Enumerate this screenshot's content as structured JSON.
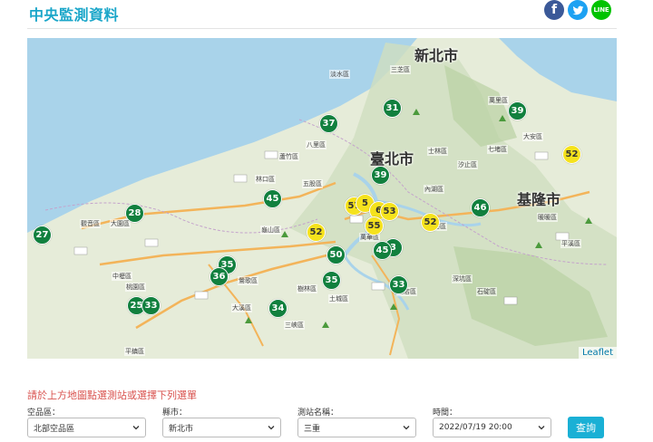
{
  "header": {
    "title": "中央監測資料"
  },
  "social": {
    "facebook": "f",
    "twitter": "twitter-icon",
    "line": "LINE"
  },
  "map": {
    "attribution": "Leaflet",
    "cities": [
      "新北市",
      "臺北市",
      "基隆市"
    ],
    "districts": [
      "淡水區",
      "三芝區",
      "萬里區",
      "八里區",
      "蘆竹區",
      "林口區",
      "五股區",
      "大園區",
      "觀音區",
      "龜山區",
      "中壢區",
      "大溪區",
      "樹林區",
      "土城區",
      "三峽區",
      "新店區",
      "汐止區",
      "南港區",
      "內湖區",
      "七堵區",
      "暖暖區",
      "平溪區",
      "石碇區",
      "深坑區",
      "萬華區",
      "士林區",
      "桃園區",
      "平鎮區",
      "鶯歌區",
      "大安區"
    ],
    "stations": [
      {
        "value": "31",
        "level": "good"
      },
      {
        "value": "37",
        "level": "good"
      },
      {
        "value": "39",
        "level": "good"
      },
      {
        "value": "39",
        "level": "good"
      },
      {
        "value": "52",
        "level": "moderate"
      },
      {
        "value": "45",
        "level": "good"
      },
      {
        "value": "28",
        "level": "good"
      },
      {
        "value": "27",
        "level": "good"
      },
      {
        "value": "57",
        "level": "moderate"
      },
      {
        "value": "5",
        "level": "moderate"
      },
      {
        "value": "6",
        "level": "moderate"
      },
      {
        "value": "53",
        "level": "moderate"
      },
      {
        "value": "52",
        "level": "moderate"
      },
      {
        "value": "55",
        "level": "moderate"
      },
      {
        "value": "52",
        "level": "moderate"
      },
      {
        "value": "46",
        "level": "good"
      },
      {
        "value": "50",
        "level": "good"
      },
      {
        "value": "3",
        "level": "good"
      },
      {
        "value": "45",
        "level": "good"
      },
      {
        "value": "35",
        "level": "good"
      },
      {
        "value": "36",
        "level": "good"
      },
      {
        "value": "35",
        "level": "good"
      },
      {
        "value": "33",
        "level": "good"
      },
      {
        "value": "25",
        "level": "good"
      },
      {
        "value": "33",
        "level": "good"
      },
      {
        "value": "34",
        "level": "good"
      }
    ],
    "colors": {
      "good": "#11803e",
      "moderate": "#f5e21d",
      "sea": "#a9d3ea"
    }
  },
  "form": {
    "instruction": "請於上方地圖點選測站或選擇下列選單",
    "region_label": "空品區：",
    "region_value": "北部空品區",
    "city_label": "縣市：",
    "city_value": "新北市",
    "station_label": "測站名稱：",
    "station_value": "三重",
    "time_label": "時間：",
    "time_value": "2022/07/19 20:00",
    "query_label": "查詢"
  }
}
